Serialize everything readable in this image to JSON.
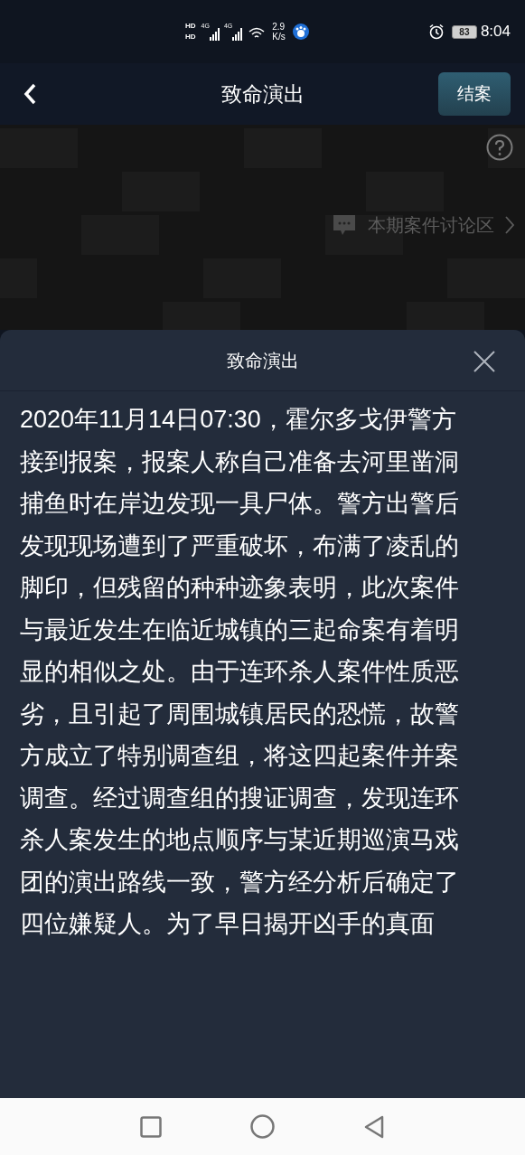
{
  "status_bar": {
    "sim_labels": [
      "HD",
      "HD"
    ],
    "network_labels": [
      "4G",
      "4G"
    ],
    "speed": "2.9",
    "speed_unit": "K/s",
    "battery": "83",
    "time": "8:04"
  },
  "header": {
    "title": "致命演出",
    "action_button": "结案"
  },
  "banner": {
    "kind": "picture",
    "discussion_link": "本期案件讨论区"
  },
  "sheet": {
    "title": "致命演出",
    "body_lines": [
      "2020年11月14日07:30，霍尔多戈伊警方",
      "接到报案，报案人称自己准备去河里凿洞",
      "捕鱼时在岸边发现一具尸体。警方出警后",
      "发现现场遭到了严重破坏，布满了凌乱的",
      "脚印，但残留的种种迹象表明，此次案件",
      "与最近发生在临近城镇的三起命案有着明",
      "显的相似之处。由于连环杀人案件性质恶",
      "劣，且引起了周围城镇居民的恐慌，故警",
      "方成立了特别调查组，将这四起案件并案",
      "调查。经过调查组的搜证调查，发现连环",
      "杀人案发生的地点顺序与某近期巡演马戏",
      "团的演出路线一致，警方经分析后确定了",
      "四位嫌疑人。为了早日揭开凶手的真面"
    ]
  }
}
